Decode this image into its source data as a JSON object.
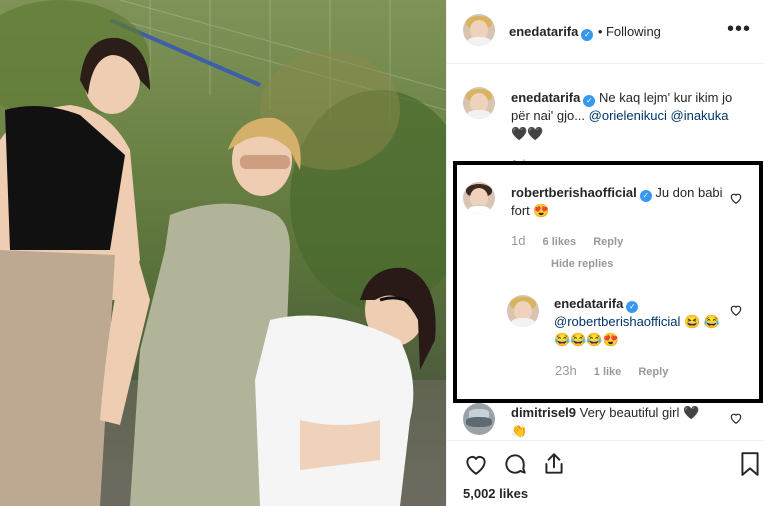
{
  "post": {
    "username": "enedatarifa",
    "follow_status": "• Following"
  },
  "caption": {
    "username": "enedatarifa",
    "text": "Ne kaq lejm' kur ikim jo për nai' gjo...",
    "mention1": "@orielenikuci",
    "mention2": "@inakuka",
    "hearts": "🖤🖤",
    "age": "1d"
  },
  "comments": [
    {
      "username": "robertberishaofficial",
      "text": "Ju don babi fort",
      "emoji": "😍",
      "time": "1d",
      "likes": "6 likes",
      "reply": "Reply",
      "hide_replies": "Hide replies"
    },
    {
      "username": "enedatarifa",
      "mention": "@robertberishaofficial",
      "text": "😆",
      "emoji": "😂😂😂😂😍",
      "time": "23h",
      "likes": "1 like",
      "reply": "Reply"
    },
    {
      "username": "dimitrisel9",
      "text": "Very beautiful girl",
      "heart": "🖤",
      "extra": "👏"
    }
  ],
  "footer": {
    "likes": "5,002 likes"
  },
  "icons": {
    "more": "more-options-icon",
    "like": "heart-icon",
    "comment": "comment-icon",
    "share": "share-icon",
    "save": "bookmark-icon"
  },
  "colors": {
    "verified": "#3897f0",
    "mention": "#003569",
    "highlight_border": "#000000"
  }
}
